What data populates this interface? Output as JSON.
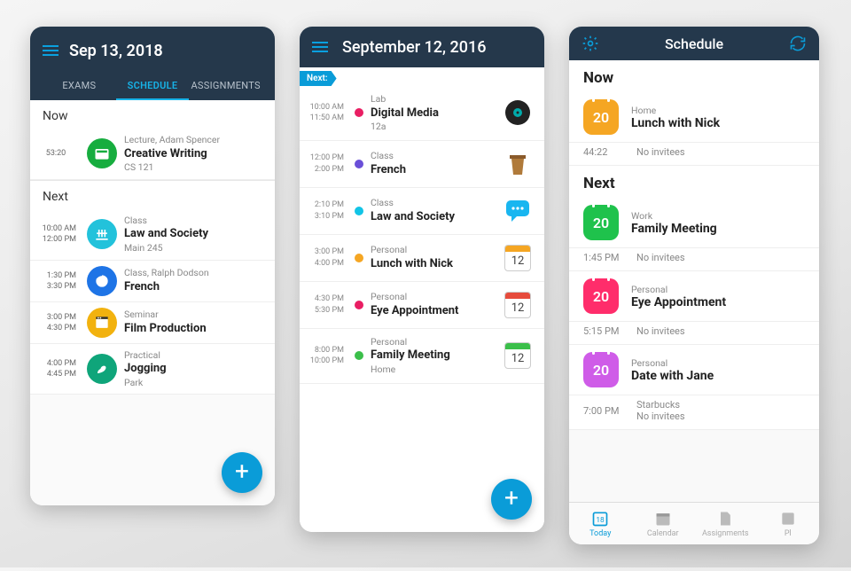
{
  "colors": {
    "accent": "#0a9cd8",
    "header": "#25384b"
  },
  "phone1": {
    "date": "Sep 13, 2018",
    "tabs": {
      "exams": "EXAMS",
      "schedule": "SCHEDULE",
      "assignments": "ASSIGNMENTS"
    },
    "now_label": "Now",
    "now_item": {
      "countdown": "53:20",
      "sub": "Lecture, Adam Spencer",
      "title": "Creative Writing",
      "room": "CS 121",
      "icon_color": "#17ad3f"
    },
    "next_label": "Next",
    "next": [
      {
        "t1": "10:00 AM",
        "t2": "12:00 PM",
        "sub": "Class",
        "title": "Law and Society",
        "room": "Main 245",
        "icon_color": "#22c2db"
      },
      {
        "t1": "1:30 PM",
        "t2": "3:30 PM",
        "sub": "Class, Ralph Dodson",
        "title": "French",
        "room": "",
        "icon_color": "#1e74e6"
      },
      {
        "t1": "3:00 PM",
        "t2": "4:30 PM",
        "sub": "Seminar",
        "title": "Film Production",
        "room": "",
        "icon_color": "#f2b20f"
      },
      {
        "t1": "4:00 PM",
        "t2": "4:45 PM",
        "sub": "Practical",
        "title": "Jogging",
        "room": "Park",
        "icon_color": "#0fa57a"
      }
    ]
  },
  "phone2": {
    "date": "September 12, 2016",
    "next_ribbon": "Next:",
    "items": [
      {
        "t1": "10:00 AM",
        "t2": "11:50 AM",
        "cat": "Lab",
        "title": "Digital Media",
        "note": "12a",
        "dot": "#e91e63",
        "icon": "vinyl"
      },
      {
        "t1": "12:00 PM",
        "t2": "2:00 PM",
        "cat": "Class",
        "title": "French",
        "note": "",
        "dot": "#6a4fd8",
        "icon": "podium"
      },
      {
        "t1": "2:10 PM",
        "t2": "3:10 PM",
        "cat": "Class",
        "title": "Law and Society",
        "note": "",
        "dot": "#12c4e6",
        "icon": "chat"
      },
      {
        "t1": "3:00 PM",
        "t2": "4:00 PM",
        "cat": "Personal",
        "title": "Lunch with Nick",
        "note": "",
        "dot": "#f5a623",
        "icon": "cal-orange",
        "cal_num": "12"
      },
      {
        "t1": "4:30 PM",
        "t2": "5:30 PM",
        "cat": "Personal",
        "title": "Eye Appointment",
        "note": "",
        "dot": "#e91e63",
        "icon": "cal-red",
        "cal_num": "12"
      },
      {
        "t1": "8:00 PM",
        "t2": "10:00 PM",
        "cat": "Personal",
        "title": "Family Meeting",
        "note": "Home",
        "dot": "#3bbf4a",
        "icon": "cal-green",
        "cal_num": "12"
      }
    ]
  },
  "phone3": {
    "title": "Schedule",
    "now_label": "Now",
    "now": {
      "cat": "Home",
      "title": "Lunch with Nick",
      "time": "44:22",
      "invitees": "No invitees",
      "color": "#f5a623",
      "day": "20"
    },
    "next_label": "Next",
    "next": [
      {
        "cat": "Work",
        "title": "Family Meeting",
        "time": "1:45 PM",
        "invitees": "No invitees",
        "color": "#1fc24c",
        "day": "20"
      },
      {
        "cat": "Personal",
        "title": "Eye Appointment",
        "time": "5:15 PM",
        "invitees": "No invitees",
        "color": "#ff2d6b",
        "day": "20"
      },
      {
        "cat": "Personal",
        "title": "Date with Jane",
        "time": "7:00 PM",
        "loc": "Starbucks",
        "invitees": "No invitees",
        "color": "#cf5ce8",
        "day": "20"
      }
    ],
    "tabs": {
      "today": "Today",
      "today_day": "18",
      "calendar": "Calendar",
      "assignments": "Assignments",
      "planner": "Pl"
    }
  }
}
